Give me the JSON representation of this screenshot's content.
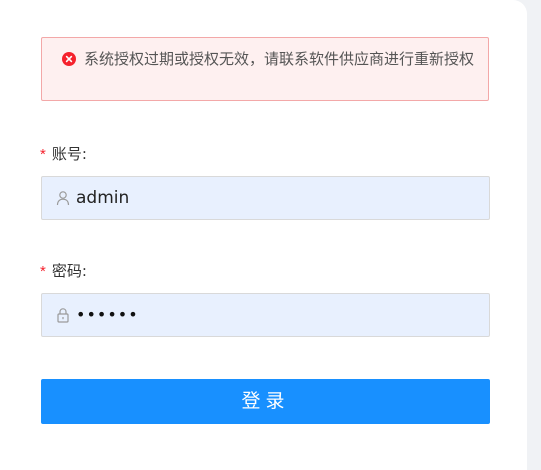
{
  "alert": {
    "icon": "close-circle-icon",
    "message": "系统授权过期或授权无效，请联系软件供应商进行重新授权",
    "color": "#f5222d"
  },
  "form": {
    "account": {
      "required_mark": "*",
      "label": "账号:",
      "icon": "user-icon",
      "value": "admin"
    },
    "password": {
      "required_mark": "*",
      "label": "密码:",
      "icon": "lock-icon",
      "value": "••••••"
    }
  },
  "login_button": {
    "label": "登录",
    "color": "#1890ff"
  }
}
